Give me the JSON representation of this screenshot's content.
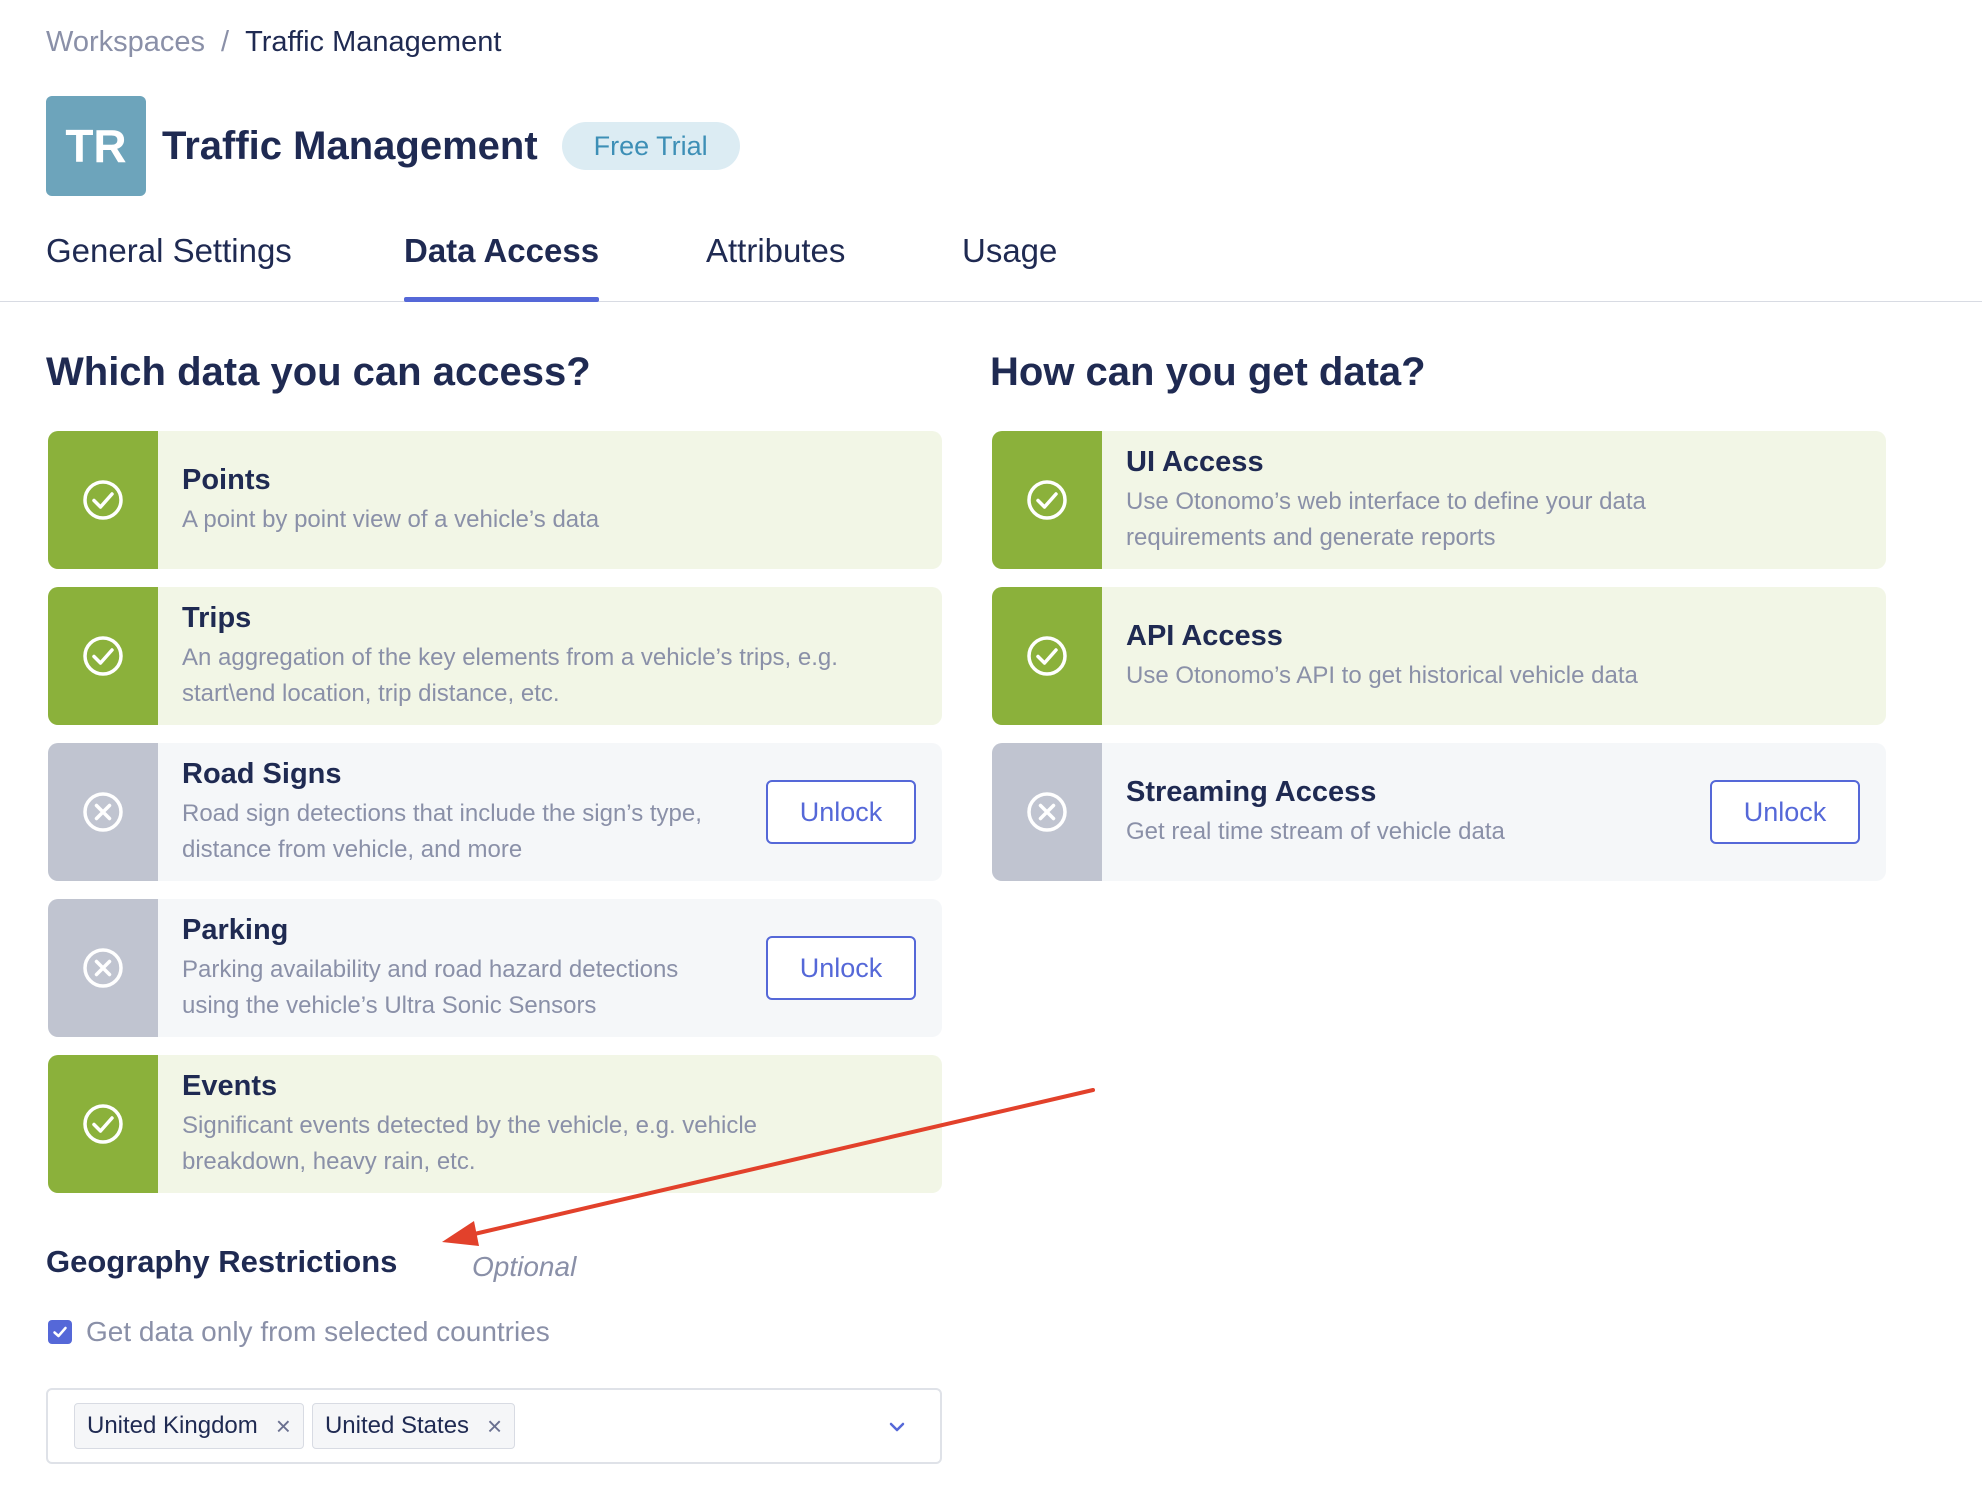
{
  "breadcrumb": {
    "workspaces": "Workspaces",
    "separator": "/",
    "current": "Traffic Management"
  },
  "header": {
    "avatar_initials": "TR",
    "title": "Traffic Management",
    "badge": "Free Trial"
  },
  "tabs": [
    {
      "label": "General Settings",
      "active": false
    },
    {
      "label": "Data Access",
      "active": true
    },
    {
      "label": "Attributes",
      "active": false
    },
    {
      "label": "Usage",
      "active": false
    }
  ],
  "data_section": {
    "title": "Which data you can access?",
    "cards": [
      {
        "title": "Points",
        "desc": [
          "A point by point view of a vehicle’s data"
        ],
        "enabled": true
      },
      {
        "title": "Trips",
        "desc": [
          "An aggregation of the key elements from a vehicle’s trips, e.g.",
          "start\\end location, trip distance, etc."
        ],
        "enabled": true
      },
      {
        "title": "Road Signs",
        "desc": [
          "Road sign detections that include the sign’s type,",
          "distance from vehicle, and more"
        ],
        "enabled": false,
        "action": "Unlock"
      },
      {
        "title": "Parking",
        "desc": [
          "Parking availability and road hazard detections",
          "using the vehicle’s Ultra Sonic Sensors"
        ],
        "enabled": false,
        "action": "Unlock"
      },
      {
        "title": "Events",
        "desc": [
          "Significant events detected by the vehicle, e.g. vehicle",
          "breakdown, heavy rain, etc."
        ],
        "enabled": true
      }
    ]
  },
  "access_section": {
    "title": "How can you get data?",
    "cards": [
      {
        "title": "UI Access",
        "desc": [
          "Use Otonomo’s web interface to define your data",
          "requirements and generate reports"
        ],
        "enabled": true
      },
      {
        "title": "API Access",
        "desc": [
          "Use Otonomo’s API to get historical vehicle data"
        ],
        "enabled": true
      },
      {
        "title": "Streaming Access",
        "desc": [
          "Get real time stream of vehicle data"
        ],
        "enabled": false,
        "action": "Unlock"
      }
    ]
  },
  "geography": {
    "title": "Geography Restrictions",
    "optional": "Optional",
    "checkbox_label": "Get data only from selected countries",
    "checkbox_checked": true,
    "selected_countries": [
      "United Kingdom",
      "United States"
    ],
    "remove_glyph": "×"
  },
  "colors": {
    "accent": "#5568d8",
    "enabled_green": "#8bb13b",
    "disabled_gray": "#c0c4d0",
    "annotation_arrow": "#e2412b"
  }
}
